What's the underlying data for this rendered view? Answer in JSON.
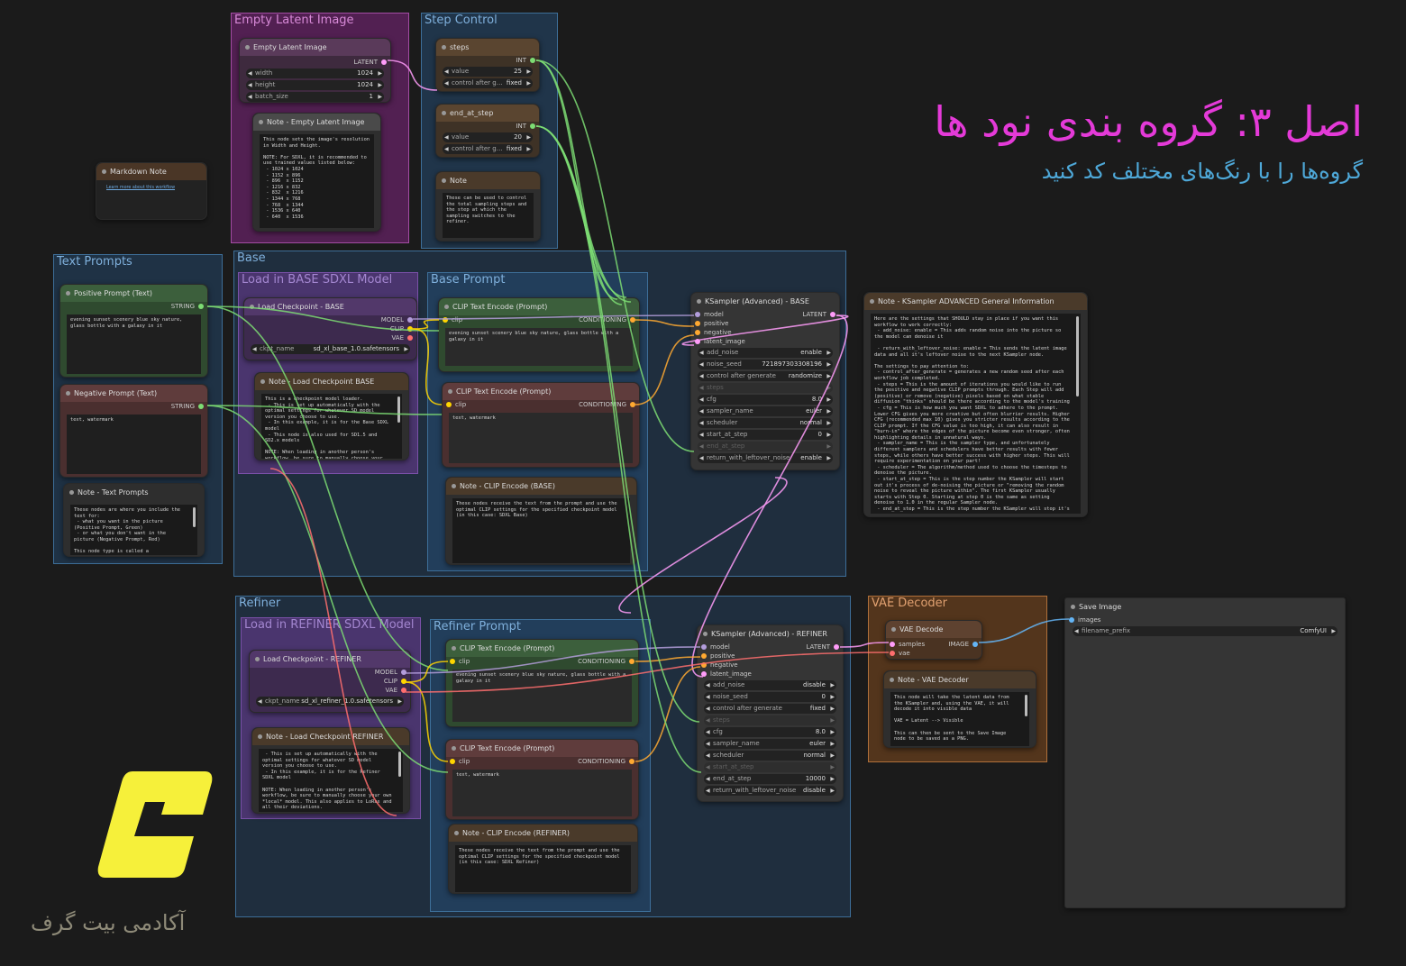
{
  "header": {
    "title": "اصل ۳: گروه بندی نود ها",
    "subtitle": "گروه‌ها را با رنگ‌های مختلف کد کنید"
  },
  "brand": {
    "name": "آکادمی بیت گرف"
  },
  "groups": {
    "empty_latent": "Empty Latent Image",
    "step_control": "Step Control",
    "text_prompts": "Text Prompts",
    "base": "Base",
    "load_base": "Load in BASE SDXL Model",
    "base_prompt": "Base Prompt",
    "refiner": "Refiner",
    "load_refiner": "Load in REFINER SDXL Model",
    "refiner_prompt": "Refiner Prompt",
    "vae_decoder": "VAE Decoder"
  },
  "empty_latent": {
    "title": "Empty Latent Image",
    "out": "LATENT",
    "width_label": "width",
    "width": "1024",
    "height_label": "height",
    "height": "1024",
    "batch_label": "batch_size",
    "batch": "1"
  },
  "note_latent": {
    "title": "Note - Empty Latent Image",
    "text": "This node sets the image's resolution in Width and Height.\n\nNOTE: For SDXL, it is recommended to use trained values listed below:\n - 1024 x 1024\n - 1152 x 896\n - 896  x 1152\n - 1216 x 832\n - 832  x 1216\n - 1344 x 768\n - 768  x 1344\n - 1536 x 640\n - 640  x 1536"
  },
  "markdown": {
    "title": "Markdown Note",
    "link": "Learn more about this workflow"
  },
  "steps": {
    "title": "steps",
    "out": "INT",
    "value_label": "value",
    "value": "25",
    "ctrl_label": "control after g…",
    "ctrl": "fixed"
  },
  "end_at": {
    "title": "end_at_step",
    "out": "INT",
    "value_label": "value",
    "value": "20",
    "ctrl_label": "control after g…",
    "ctrl": "fixed"
  },
  "note_steps": {
    "title": "Note",
    "text": "These can be used to control the total sampling steps and the step at which the sampling switches to the refiner."
  },
  "pos_prompt": {
    "title": "Positive Prompt (Text)",
    "out": "STRING",
    "text": "evening sunset scenery blue sky nature, glass bottle with a galaxy in it"
  },
  "neg_prompt": {
    "title": "Negative Prompt (Text)",
    "out": "STRING",
    "text": "text, watermark"
  },
  "note_text": {
    "title": "Note - Text Prompts",
    "text": "These nodes are where you include the text for:\n - what you want in the picture (Positive Prompt, Green)\n - or what you don't want in the picture (Negative Prompt, Red)\n\nThis node type is called a \"PrimitiveNode\""
  },
  "ckpt_base": {
    "title": "Load Checkpoint - BASE",
    "model": "MODEL",
    "clip": "CLIP",
    "vae": "VAE",
    "label": "ckpt_name",
    "value": "sd_xl_base_1.0.safetensors"
  },
  "note_ckpt_base": {
    "title": "Note - Load Checkpoint BASE",
    "text": "This is a checkpoint model loader.\n - This is set up automatically with the optimal settings for whatever SD model version you choose to use.\n - In this example, it is for the Base SDXL model\n - This node is also used for SD1.5 and SD2.x models\n\nNOTE: When loading in another person's workflow, be sure to manually choose your own *local* model."
  },
  "clip_base_pos": {
    "title": "CLIP Text Encode (Prompt)",
    "in": "clip",
    "out": "CONDITIONING",
    "text": "evening sunset scenery blue sky nature, glass bottle with a galaxy in it"
  },
  "clip_base_neg": {
    "title": "CLIP Text Encode (Prompt)",
    "in": "clip",
    "out": "CONDITIONING",
    "text": "text, watermark"
  },
  "note_clip_base": {
    "title": "Note - CLIP Encode (BASE)",
    "text": "These nodes receive the text from the prompt and use the optimal CLIP settings for the specified checkpoint model (in this case: SDXL Base)"
  },
  "ks_base": {
    "title": "KSampler (Advanced) - BASE",
    "inputs": [
      "model",
      "positive",
      "negative",
      "latent_image"
    ],
    "out": "LATENT",
    "widgets": [
      [
        "add_noise",
        "enable"
      ],
      [
        "noise_seed",
        "721897303308196"
      ],
      [
        "control after generate",
        "randomize"
      ],
      [
        "steps",
        ""
      ],
      [
        "cfg",
        "8.0"
      ],
      [
        "sampler_name",
        "euler"
      ],
      [
        "scheduler",
        "normal"
      ],
      [
        "start_at_step",
        "0"
      ],
      [
        "end_at_step",
        ""
      ],
      [
        "return_with_leftover_noise",
        "enable"
      ]
    ]
  },
  "note_ks": {
    "title": "Note - KSampler  ADVANCED General Information",
    "text": "Here are the settings that SHOULD stay in place if you want this workflow to work correctly:\n - add_noise: enable = This adds random noise into the picture so the model can denoise it\n\n - return_with_leftover_noise: enable = This sends the latent image data and all it's leftover noise to the next KSampler node.\n\nThe settings to pay attention to:\n - control_after_generate = generates a new random seed after each workflow job completed.\n - steps = This is the amount of iterations you would like to run the positive and negative CLIP prompts through. Each Step will add (positive) or remove (negative) pixels based on what stable diffusion \"thinks\" should be there according to the model's training\n - cfg = This is how much you want SDXL to adhere to the prompt. Lower CFG gives you more creative but often blurrier results. Higher CFG (recommended max 10) gives you stricter results according to the CLIP prompt. If the CFG value is too high, it can also result in \"burn-in\" where the edges of the picture become even stronger, often highlighting details in unnatural ways.\n - sampler_name = This is the sampler type, and unfortunately different samplers and schedulers have better results with fewer steps, while others have better success with higher steps. This will require experimentation on your part!\n - scheduler = The algorithm/method used to choose the timesteps to denoise the picture.\n - start_at_step = This is the step number the KSampler will start out it's process of de-noising the picture or \"removing the random noise to reveal the picture within\". The first KSampler usually starts with Step 0. Starting at step 0 is the same as setting denoise to 1.0 in the regular Sampler node.\n - end_at_step = This is the step number the KSampler will stop it's"
  },
  "ckpt_ref": {
    "title": "Load Checkpoint - REFINER",
    "model": "MODEL",
    "clip": "CLIP",
    "vae": "VAE",
    "label": "ckpt_name",
    "value": "sd_xl_refiner_1.0.safetensors"
  },
  "note_ckpt_ref": {
    "title": "Note - Load Checkpoint REFINER",
    "text": " - This is set up automatically with the optimal settings for whatever SD model version you choose to use.\n - In this example, it is for the Refiner SDXL model\n\nNOTE: When loading in another person's workflow, be sure to manually choose your own *local* model. This also applies to LoRas and all their deviations."
  },
  "clip_ref_pos": {
    "title": "CLIP Text Encode (Prompt)",
    "in": "clip",
    "out": "CONDITIONING",
    "text": "evening sunset scenery blue sky nature, glass bottle with a galaxy in it"
  },
  "clip_ref_neg": {
    "title": "CLIP Text Encode (Prompt)",
    "in": "clip",
    "out": "CONDITIONING",
    "text": "text, watermark"
  },
  "note_clip_ref": {
    "title": "Note - CLIP Encode (REFINER)",
    "text": "These nodes receive the text from the prompt and use the optimal CLIP settings for the specified checkpoint model (in this case: SDXL Refiner)"
  },
  "ks_ref": {
    "title": "KSampler (Advanced) - REFINER",
    "inputs": [
      "model",
      "positive",
      "negative",
      "latent_image"
    ],
    "out": "LATENT",
    "widgets": [
      [
        "add_noise",
        "disable"
      ],
      [
        "noise_seed",
        "0"
      ],
      [
        "control after generate",
        "fixed"
      ],
      [
        "steps",
        ""
      ],
      [
        "cfg",
        "8.0"
      ],
      [
        "sampler_name",
        "euler"
      ],
      [
        "scheduler",
        "normal"
      ],
      [
        "start_at_step",
        ""
      ],
      [
        "end_at_step",
        "10000"
      ],
      [
        "return_with_leftover_noise",
        "disable"
      ]
    ]
  },
  "vae_decode": {
    "title": "VAE Decode",
    "samples": "samples",
    "vae": "vae",
    "out": "IMAGE"
  },
  "note_vae": {
    "title": "Note - VAE Decoder",
    "text": "This node will take the latent data from the KSampler and, using the VAE, it will decode it into visible data\n\nVAE = Latent --> Visible\n\nThis can then be sent to the Save Image node to be saved as a PNG."
  },
  "save": {
    "title": "Save Image",
    "in": "images",
    "label": "filename_prefix",
    "value": "ComfyUI"
  },
  "colors": {
    "model": "#b39ddb",
    "clip": "#ffd500",
    "vae": "#ff6e6e",
    "latent": "#ff9cf9",
    "cond": "#ffa931",
    "int": "#7ddc73",
    "string": "#7ddc73",
    "image": "#64b5f6",
    "brand": "#f6f03a"
  }
}
